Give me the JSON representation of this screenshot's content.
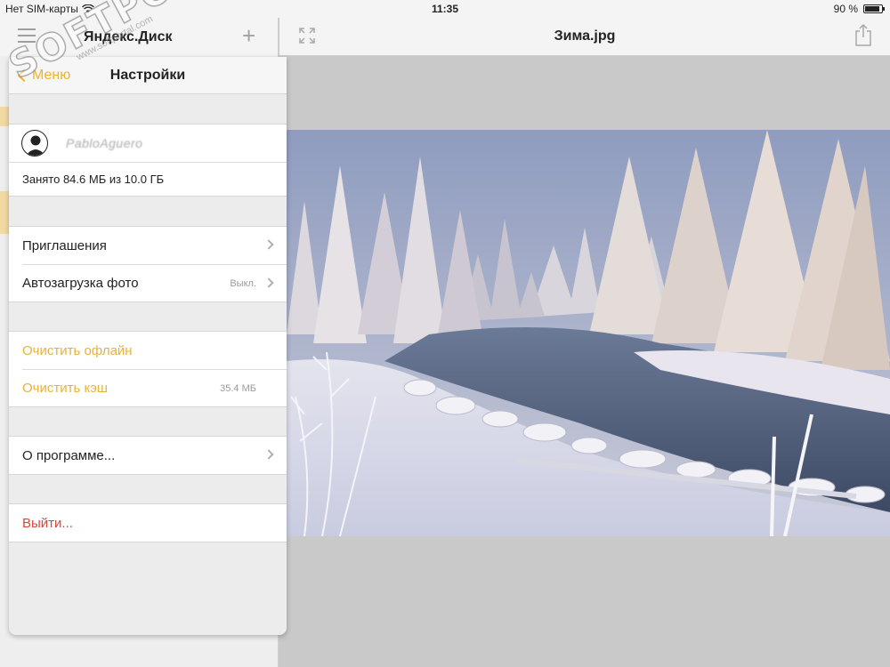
{
  "status_bar": {
    "carrier": "Нет SIM-карты",
    "time": "11:35",
    "battery_text": "90 %",
    "battery_level": 0.9
  },
  "left_nav": {
    "title": "Яндекс.Диск",
    "plus_label": "+"
  },
  "right_nav": {
    "title": "Зима.jpg"
  },
  "settings": {
    "back_label": "Меню",
    "title": "Настройки",
    "user_name": "PabloAguero",
    "storage_text": "Занято 84.6 МБ из 10.0 ГБ",
    "items": {
      "invites": "Приглашения",
      "photo_upload": "Автозагрузка фото",
      "photo_upload_value": "Выкл.",
      "clear_offline": "Очистить офлайн",
      "clear_cache": "Очистить кэш",
      "clear_cache_value": "35.4 МБ",
      "about": "О программе...",
      "logout": "Выйти..."
    }
  },
  "watermark": {
    "main": "SOFTPORTAL",
    "sub": "www.softportal.com"
  },
  "colors": {
    "accent": "#f0b429",
    "danger": "#d9453a"
  }
}
